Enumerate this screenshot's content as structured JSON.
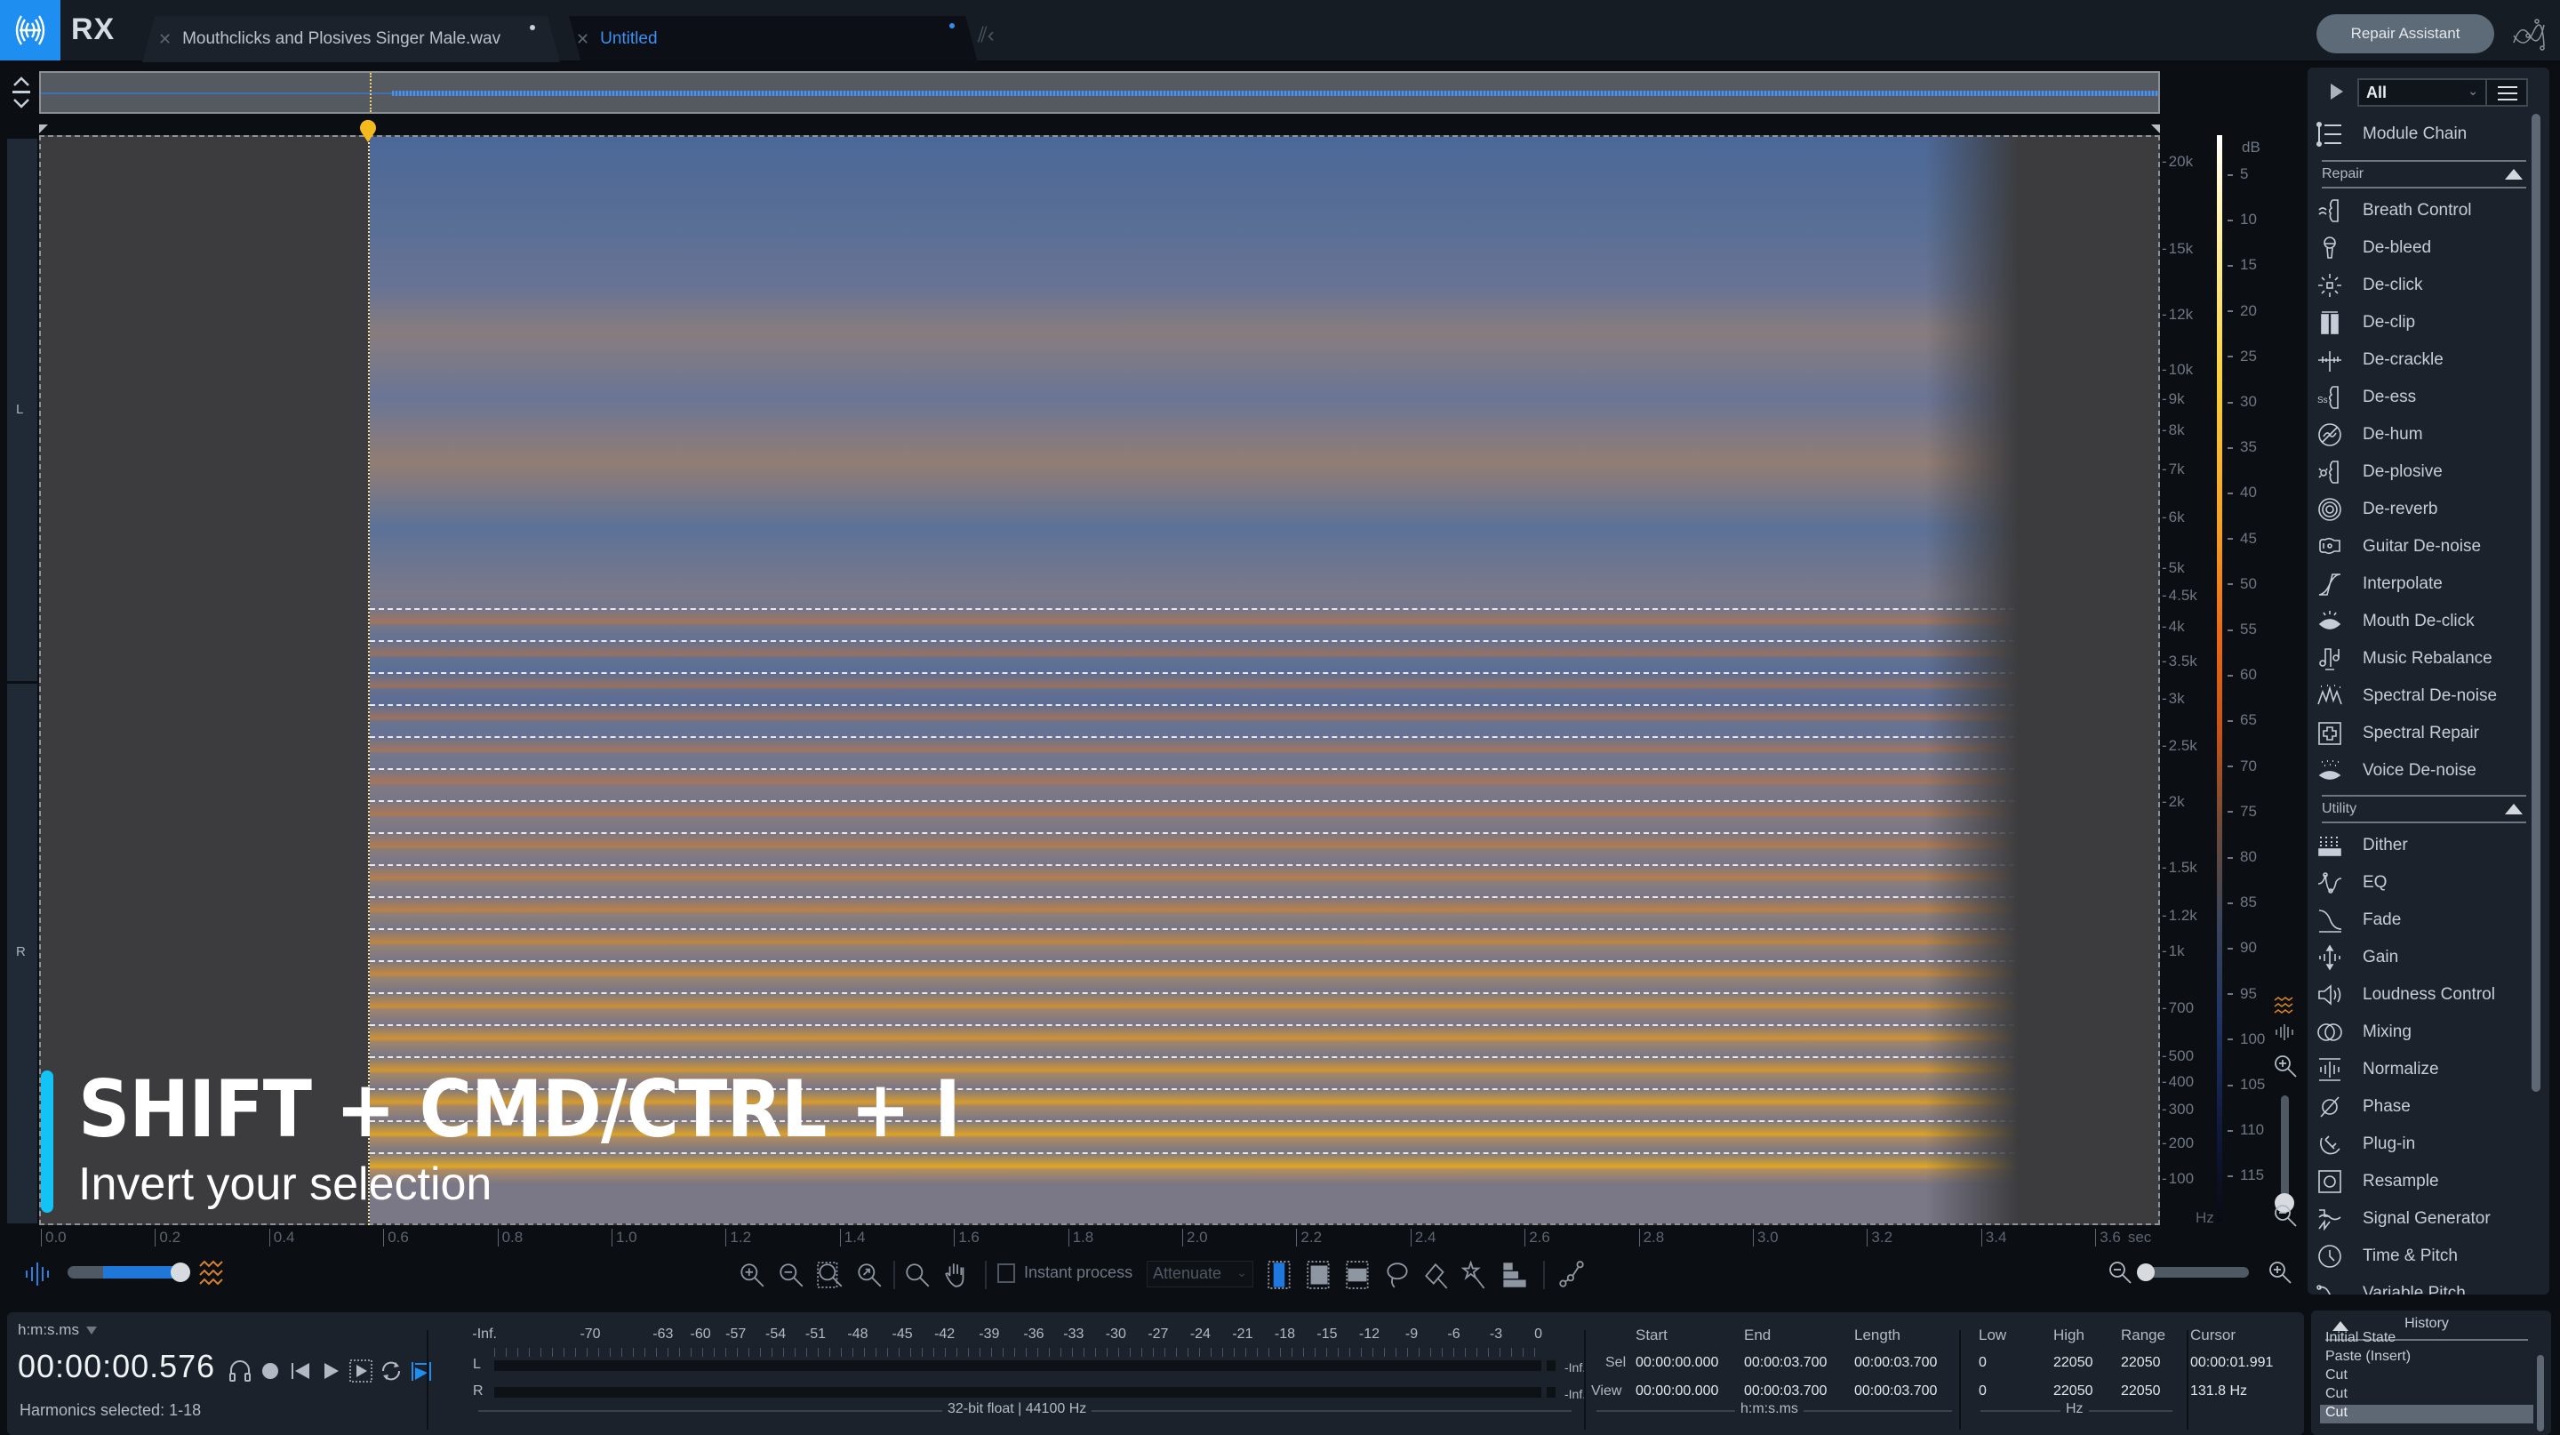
{
  "app": {
    "name": "RX",
    "accent_color": "#1e8ff0"
  },
  "tabs": [
    {
      "label": "Mouthclicks and Plosives Singer Male.wav",
      "active": false,
      "modified": true
    },
    {
      "label": "Untitled",
      "active": true,
      "modified": true
    }
  ],
  "header": {
    "repair_assistant_label": "Repair Assistant"
  },
  "spectrogram": {
    "channels": [
      "L",
      "R"
    ],
    "playhead_time_sec": 0.576,
    "selection": "harmonics 1-18",
    "freq_ticks": [
      "20k",
      "15k",
      "12k",
      "10k",
      "9k",
      "8k",
      "7k",
      "6k",
      "5k",
      "4.5k",
      "4k",
      "3.5k",
      "3k",
      "2.5k",
      "2k",
      "1.5k",
      "1.2k",
      "1k",
      "700",
      "500",
      "400",
      "300",
      "200",
      "100"
    ],
    "freq_unit": "Hz",
    "db_label": "dB",
    "db_ticks": [
      "5",
      "10",
      "15",
      "20",
      "25",
      "30",
      "35",
      "40",
      "45",
      "50",
      "55",
      "60",
      "65",
      "70",
      "75",
      "80",
      "85",
      "90",
      "95",
      "100",
      "105",
      "110",
      "115"
    ],
    "time_ticks": [
      "0.0",
      "0.2",
      "0.4",
      "0.6",
      "0.8",
      "1.0",
      "1.2",
      "1.4",
      "1.6",
      "1.8",
      "2.0",
      "2.2",
      "2.4",
      "2.6",
      "2.8",
      "3.0",
      "3.2",
      "3.4",
      "3.6"
    ],
    "time_unit": "sec"
  },
  "caption": {
    "shortcut": "SHIFT + CMD/CTRL + I",
    "description": "Invert your selection",
    "bar_color": "#13c3f5"
  },
  "toolbar": {
    "instant_process_label": "Instant process",
    "instant_process_checked": false,
    "mode_value": "Attenuate"
  },
  "module_panel": {
    "filter_value": "All",
    "module_chain_label": "Module Chain",
    "sections": [
      {
        "title": "Repair",
        "modules": [
          {
            "label": "Breath Control",
            "icon": "breath-control-icon"
          },
          {
            "label": "De-bleed",
            "icon": "microphone-icon"
          },
          {
            "label": "De-click",
            "icon": "de-click-icon"
          },
          {
            "label": "De-clip",
            "icon": "de-clip-icon"
          },
          {
            "label": "De-crackle",
            "icon": "de-crackle-icon"
          },
          {
            "label": "De-ess",
            "icon": "de-ess-icon"
          },
          {
            "label": "De-hum",
            "icon": "de-hum-icon"
          },
          {
            "label": "De-plosive",
            "icon": "de-plosive-icon"
          },
          {
            "label": "De-reverb",
            "icon": "de-reverb-icon"
          },
          {
            "label": "Guitar De-noise",
            "icon": "guitar-icon"
          },
          {
            "label": "Interpolate",
            "icon": "interpolate-icon"
          },
          {
            "label": "Mouth De-click",
            "icon": "mouth-icon"
          },
          {
            "label": "Music Rebalance",
            "icon": "music-rebalance-icon"
          },
          {
            "label": "Spectral De-noise",
            "icon": "spectral-denoise-icon"
          },
          {
            "label": "Spectral Repair",
            "icon": "spectral-repair-icon"
          },
          {
            "label": "Voice De-noise",
            "icon": "voice-denoise-icon"
          }
        ]
      },
      {
        "title": "Utility",
        "modules": [
          {
            "label": "Dither",
            "icon": "dither-icon"
          },
          {
            "label": "EQ",
            "icon": "eq-icon"
          },
          {
            "label": "Fade",
            "icon": "fade-icon"
          },
          {
            "label": "Gain",
            "icon": "gain-icon"
          },
          {
            "label": "Loudness Control",
            "icon": "speaker-icon"
          },
          {
            "label": "Mixing",
            "icon": "mixing-icon"
          },
          {
            "label": "Normalize",
            "icon": "normalize-icon"
          },
          {
            "label": "Phase",
            "icon": "phase-icon"
          },
          {
            "label": "Plug-in",
            "icon": "plug-icon"
          },
          {
            "label": "Resample",
            "icon": "resample-icon"
          },
          {
            "label": "Signal Generator",
            "icon": "signal-generator-icon"
          },
          {
            "label": "Time & Pitch",
            "icon": "clock-icon"
          },
          {
            "label": "Variable Pitch",
            "icon": "variable-pitch-icon"
          }
        ]
      }
    ]
  },
  "history": {
    "title": "History",
    "items": [
      "Initial State",
      "Paste (Insert)",
      "Cut",
      "Cut",
      "Cut"
    ],
    "selected_index": 4
  },
  "transport": {
    "time_format": "h:m:s.ms",
    "timecode": "00:00:00.576",
    "status": "Harmonics selected:  1-18"
  },
  "meter": {
    "scale": [
      "-Inf.",
      "-70",
      "-63",
      "-60",
      "-57",
      "-54",
      "-51",
      "-48",
      "-45",
      "-42",
      "-39",
      "-36",
      "-33",
      "-30",
      "-27",
      "-24",
      "-21",
      "-18",
      "-15",
      "-12",
      "-9",
      "-6",
      "-3",
      "0"
    ],
    "channels": [
      {
        "label": "L",
        "peak": "-Inf."
      },
      {
        "label": "R",
        "peak": "-Inf."
      }
    ],
    "format": "32-bit float | 44100 Hz"
  },
  "selection_info": {
    "time_headers": [
      "Start",
      "End",
      "Length"
    ],
    "freq_headers": [
      "Low",
      "High",
      "Range"
    ],
    "cursor_header": "Cursor",
    "rows": [
      {
        "label": "Sel",
        "start": "00:00:00.000",
        "end": "00:00:03.700",
        "length": "00:00:03.700",
        "low": "0",
        "high": "22050",
        "range": "22050",
        "cursor": "00:00:01.991"
      },
      {
        "label": "View",
        "start": "00:00:00.000",
        "end": "00:00:03.700",
        "length": "00:00:03.700",
        "low": "0",
        "high": "22050",
        "range": "22050",
        "cursor": "131.8 Hz"
      }
    ],
    "time_unit": "h:m:s.ms",
    "freq_unit": "Hz"
  }
}
